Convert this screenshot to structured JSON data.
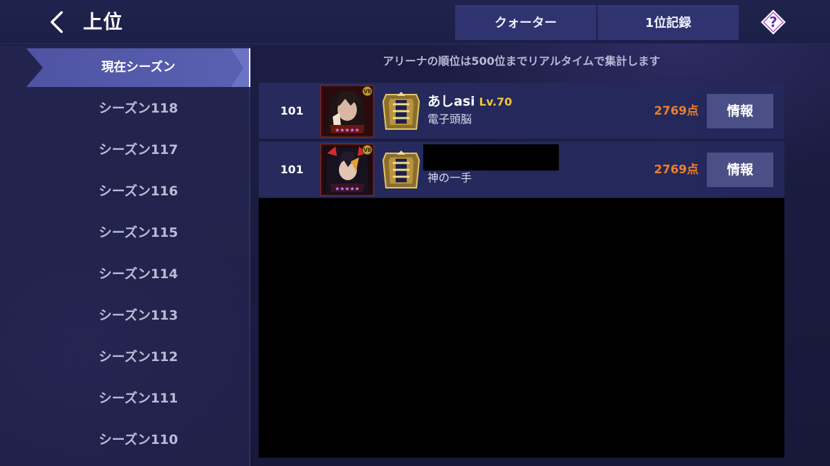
{
  "header": {
    "title": "上位",
    "tabs": [
      {
        "label": "クォーター"
      },
      {
        "label": "1位記録"
      }
    ]
  },
  "sidebar": {
    "active": "現在シーズン",
    "items": [
      {
        "label": "シーズン118"
      },
      {
        "label": "シーズン117"
      },
      {
        "label": "シーズン116"
      },
      {
        "label": "シーズン115"
      },
      {
        "label": "シーズン114"
      },
      {
        "label": "シーズン113"
      },
      {
        "label": "シーズン112"
      },
      {
        "label": "シーズン111"
      },
      {
        "label": "シーズン110"
      }
    ]
  },
  "main": {
    "notice": "アリーナの順位は500位までリアルタイムで集計します",
    "rows": [
      {
        "rank": "101",
        "name": "あしasi",
        "level": "Lv.70",
        "guild": "電子頭脳",
        "points": "2769点",
        "info_label": "情報"
      },
      {
        "rank": "101",
        "name": "",
        "level": "",
        "guild": "神の一手",
        "points": "2769点",
        "info_label": "情報"
      }
    ]
  },
  "icons": {
    "back": "chevron-left-icon",
    "help": "question-diamond-icon",
    "avatar": "hero-portrait-icon",
    "emblem": "rank-emblem-icon"
  },
  "colors": {
    "background": "#181a3c",
    "tab": "#2f3470",
    "points": "#f07f28",
    "level": "#f4c23a",
    "info_button": "#4a4f86"
  }
}
